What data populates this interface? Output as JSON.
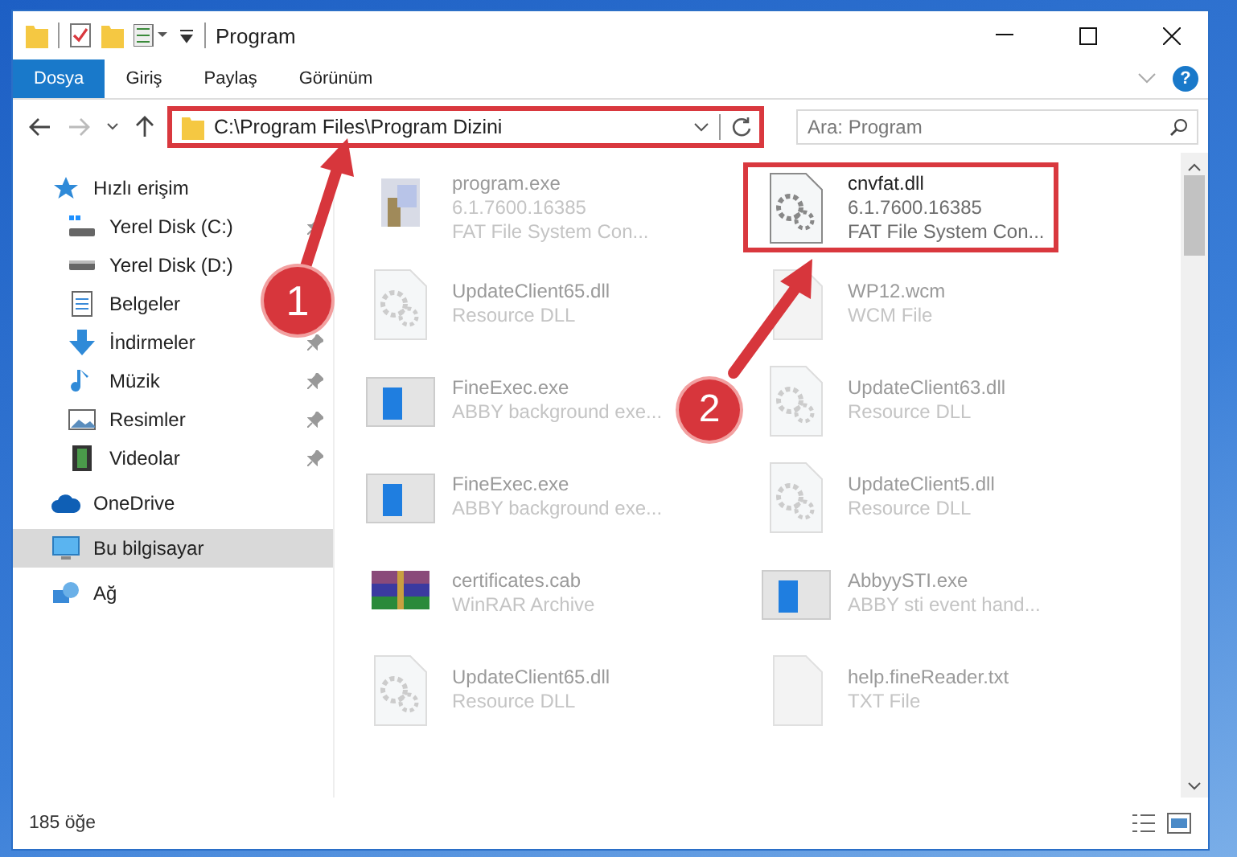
{
  "window": {
    "title": "Program"
  },
  "ribbon": {
    "tabs": [
      {
        "label": "Dosya",
        "selected": true
      },
      {
        "label": "Giriş",
        "selected": false
      },
      {
        "label": "Paylaş",
        "selected": false
      },
      {
        "label": "Görünüm",
        "selected": false
      }
    ],
    "help": "?"
  },
  "address_bar": {
    "path": "C:\\Program Files\\Program Dizini",
    "highlighted": true
  },
  "search": {
    "placeholder": "Ara: Program"
  },
  "sidebar": {
    "items": [
      {
        "label": "Hızlı erişim",
        "kind": "star",
        "selected": false,
        "children": [
          {
            "label": "Yerel Disk (C:)",
            "kind": "drive-c",
            "pinned": true,
            "selected": false
          },
          {
            "label": "Yerel Disk (D:)",
            "kind": "drive",
            "pinned": false,
            "selected": false
          },
          {
            "label": "Belgeler",
            "kind": "docs",
            "pinned": false,
            "selected": false
          },
          {
            "label": "İndirmeler",
            "kind": "download",
            "pinned": true,
            "selected": false
          },
          {
            "label": "Müzik",
            "kind": "music",
            "pinned": true,
            "selected": false
          },
          {
            "label": "Resimler",
            "kind": "pictures",
            "pinned": true,
            "selected": false
          },
          {
            "label": "Videolar",
            "kind": "video",
            "pinned": true,
            "selected": false
          }
        ]
      },
      {
        "label": "OneDrive",
        "kind": "cloud",
        "selected": false
      },
      {
        "label": "Bu bilgisayar",
        "kind": "pc",
        "selected": true
      },
      {
        "label": "Ağ",
        "kind": "network",
        "selected": false
      }
    ]
  },
  "files": [
    {
      "name": "program.exe",
      "details": [
        "6.1.7600.16385",
        "FAT File System Con..."
      ],
      "kind": "installer",
      "faded": true,
      "highlighted": false
    },
    {
      "name": "cnvfat.dll",
      "details": [
        "6.1.7600.16385",
        "FAT File System Con..."
      ],
      "kind": "gear",
      "faded": false,
      "highlighted": true
    },
    {
      "name": "UpdateClient65.dll",
      "details": [
        "Resource DLL"
      ],
      "kind": "dll",
      "faded": true,
      "highlighted": false
    },
    {
      "name": "WP12.wcm",
      "details": [
        "WCM File"
      ],
      "kind": "blank",
      "faded": true,
      "highlighted": false
    },
    {
      "name": "FineExec.exe",
      "details": [
        "ABBY background exe..."
      ],
      "kind": "app",
      "faded": true,
      "highlighted": false
    },
    {
      "name": "UpdateClient63.dll",
      "details": [
        "Resource DLL"
      ],
      "kind": "dll",
      "faded": true,
      "highlighted": false
    },
    {
      "name": "FineExec.exe",
      "details": [
        "ABBY background exe..."
      ],
      "kind": "app",
      "faded": true,
      "highlighted": false
    },
    {
      "name": "UpdateClient5.dll",
      "details": [
        "Resource DLL"
      ],
      "kind": "dll",
      "faded": true,
      "highlighted": false
    },
    {
      "name": "certificates.cab",
      "details": [
        "WinRAR Archive"
      ],
      "kind": "archive",
      "faded": true,
      "highlighted": false
    },
    {
      "name": "AbbyySTI.exe",
      "details": [
        "ABBY sti event hand..."
      ],
      "kind": "app",
      "faded": true,
      "highlighted": false
    },
    {
      "name": "UpdateClient65.dll",
      "details": [
        "Resource DLL"
      ],
      "kind": "dll",
      "faded": true,
      "highlighted": false
    },
    {
      "name": "help.fineReader.txt",
      "details": [
        "TXT File"
      ],
      "kind": "blank",
      "faded": true,
      "highlighted": false
    }
  ],
  "status_bar": {
    "count": "185 öğe"
  },
  "annotations": [
    {
      "label": "1"
    },
    {
      "label": "2"
    }
  ]
}
